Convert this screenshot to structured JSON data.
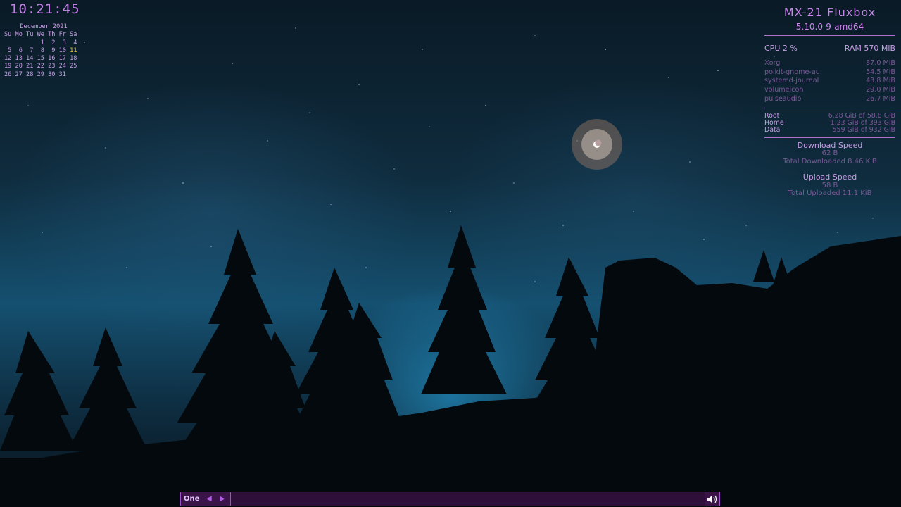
{
  "clock": {
    "time": "10:21:45"
  },
  "calendar": {
    "month": "December 2021",
    "rows": [
      "Su Mo Tu We Th Fr Sa",
      "          1  2  3  4",
      " 5  6  7  8  9 10 ",
      "12 13 14 15 16 17 18",
      "19 20 21 22 23 24 25",
      "26 27 28 29 30 31"
    ],
    "today": "11"
  },
  "system": {
    "title": "MX-21 Fluxbox",
    "kernel": "5.10.0-9-amd64",
    "cpu": "CPU 2 %",
    "ram": "RAM 570 MiB",
    "processes": [
      {
        "name": "Xorg",
        "mem": "87.0 MiB"
      },
      {
        "name": "polkit-gnome-au",
        "mem": "54.5 MiB"
      },
      {
        "name": "systemd-journal",
        "mem": "43.8 MiB"
      },
      {
        "name": "volumeicon",
        "mem": "29.0 MiB"
      },
      {
        "name": "pulseaudio",
        "mem": "26.7 MiB"
      }
    ],
    "disks": [
      {
        "label": "Root",
        "usage": "6.28 GiB of 58.8 GiB"
      },
      {
        "label": "Home",
        "usage": "1.23 GiB of 393 GiB"
      },
      {
        "label": "Data",
        "usage": "559 GiB of 932 GiB"
      }
    ],
    "download": {
      "heading": "Download Speed",
      "speed": "62 B",
      "total": "Total Downloaded 8.46 KiB"
    },
    "upload": {
      "heading": "Upload Speed",
      "speed": "58 B",
      "total": "Total Uploaded 11.1 KiB"
    }
  },
  "toolbar": {
    "workspace": "One",
    "prev_icon": "◀",
    "next_icon": "▶",
    "volume_icon": "speaker-icon"
  },
  "colors": {
    "conky_text": "#c07ae0",
    "conky_dim": "#7c5898",
    "today_highlight": "#f0c030",
    "toolbar_bg": "#3a1448",
    "toolbar_border": "#a050c8"
  }
}
